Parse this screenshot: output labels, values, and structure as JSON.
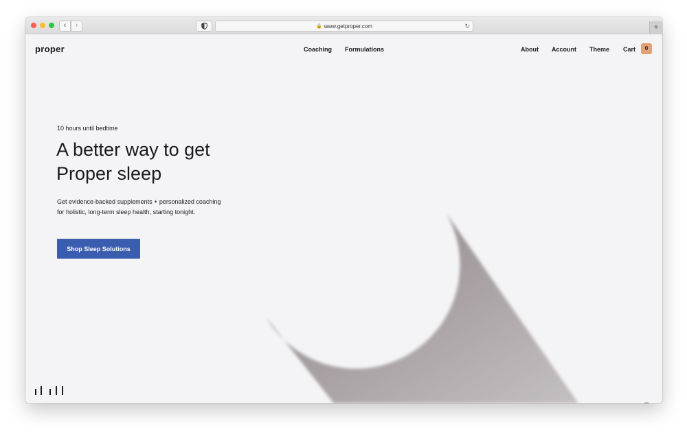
{
  "browser": {
    "url": "www.getproper.com",
    "lock_glyph": "🔒",
    "back_glyph": "‹",
    "forward_glyph": "›",
    "reload_glyph": "↻",
    "new_tab_glyph": "+"
  },
  "header": {
    "logo": "proper",
    "center_nav": [
      {
        "label": "Coaching"
      },
      {
        "label": "Formulations"
      }
    ],
    "right_nav": [
      {
        "label": "About"
      },
      {
        "label": "Account"
      },
      {
        "label": "Theme"
      },
      {
        "label": "Cart"
      }
    ],
    "cart_count": "0"
  },
  "hero": {
    "eyebrow": "10 hours until bedtime",
    "headline_line1": "A better way to get",
    "headline_line2": "Proper sleep",
    "subtext_line1": "Get evidence-backed supplements + personalized coaching",
    "subtext_line2": "for holistic, long-term sleep health, starting tonight.",
    "cta_label": "Shop Sleep Solutions"
  },
  "colors": {
    "accent": "#3a5db0",
    "cart_badge": "#e4a077",
    "page_background": "#f4f4f6",
    "shadow_dark": "#8b8284",
    "shadow_light": "#c4bfc1"
  },
  "icons": {
    "sound_bars": "sound-bars-icon",
    "theme_toggle": "theme-toggle-icon",
    "privacy": "shield-icon"
  }
}
